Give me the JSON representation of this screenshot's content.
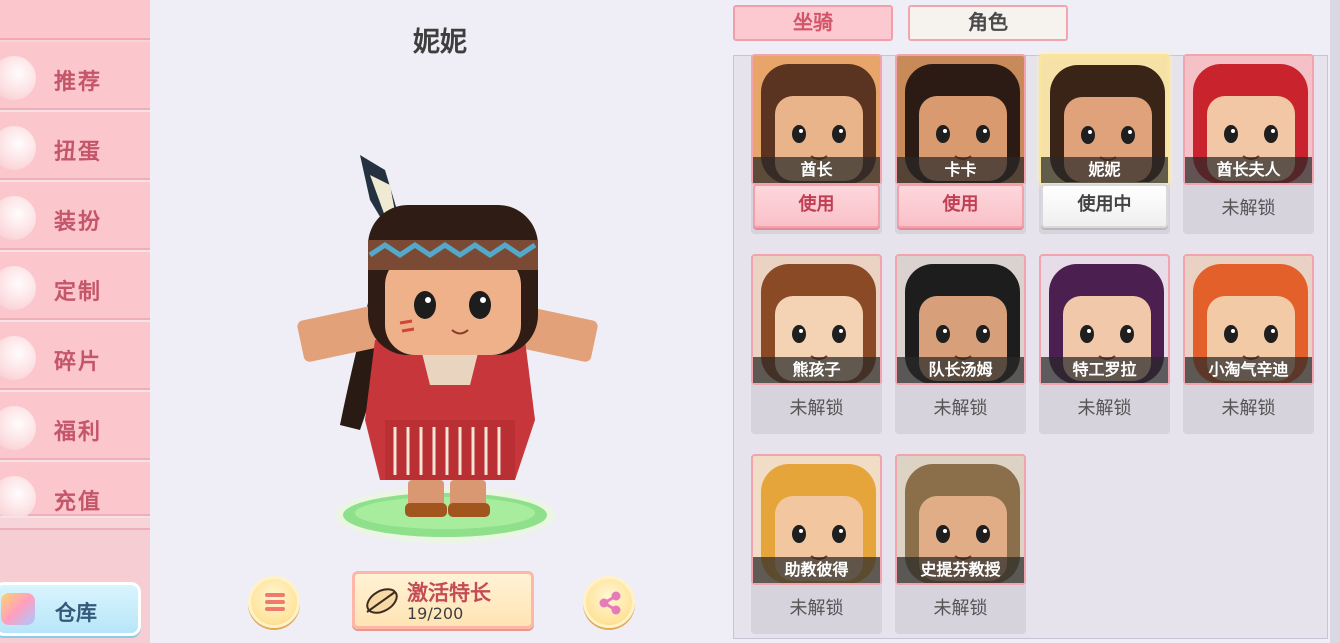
{
  "sidebar": {
    "items": [
      {
        "label": "推荐",
        "icon": "recommend-icon"
      },
      {
        "label": "扭蛋",
        "icon": "gacha-icon"
      },
      {
        "label": "装扮",
        "icon": "outfit-icon"
      },
      {
        "label": "定制",
        "icon": "customize-icon"
      },
      {
        "label": "碎片",
        "icon": "fragment-icon"
      },
      {
        "label": "福利",
        "icon": "gift-icon"
      },
      {
        "label": "充值",
        "icon": "recharge-icon"
      }
    ],
    "warehouse_label": "仓库"
  },
  "character": {
    "name": "妮妮"
  },
  "activate": {
    "title": "激活特长",
    "progress": "19/200",
    "progress_value": 19,
    "progress_max": 200
  },
  "tabs": {
    "mount": "坐骑",
    "role": "角色"
  },
  "skins": [
    {
      "name": "酋长",
      "status": "使用",
      "state": "available",
      "colors": {
        "hair": "#5a3420",
        "skin": "#e9b48a",
        "bg": "#e7a56a"
      }
    },
    {
      "name": "卡卡",
      "status": "使用",
      "state": "available",
      "colors": {
        "hair": "#2c1b14",
        "skin": "#d89a6e",
        "bg": "#c98a5a"
      }
    },
    {
      "name": "妮妮",
      "status": "使用中",
      "state": "in-use",
      "colors": {
        "hair": "#3a2418",
        "skin": "#e0a27a",
        "bg": "#f6e2a6"
      }
    },
    {
      "name": "酋长夫人",
      "status": "未解锁",
      "state": "locked",
      "colors": {
        "hair": "#c9232e",
        "skin": "#f2c7a5",
        "bg": "#f3c1c6"
      }
    },
    {
      "name": "熊孩子",
      "status": "未解锁",
      "state": "locked",
      "colors": {
        "hair": "#8a4a26",
        "skin": "#f3d3b3",
        "bg": "#ead3c2"
      }
    },
    {
      "name": "队长汤姆",
      "status": "未解锁",
      "state": "locked",
      "colors": {
        "hair": "#1d1d1d",
        "skin": "#d7a07a",
        "bg": "#d9d2cf"
      }
    },
    {
      "name": "特工罗拉",
      "status": "未解锁",
      "state": "locked",
      "colors": {
        "hair": "#4b1f4f",
        "skin": "#f1c8aa",
        "bg": "#e7dde9"
      }
    },
    {
      "name": "小淘气辛迪",
      "status": "未解锁",
      "state": "locked",
      "colors": {
        "hair": "#e4602a",
        "skin": "#f3caa6",
        "bg": "#e9d2c4"
      }
    },
    {
      "name": "助教彼得",
      "status": "未解锁",
      "state": "locked",
      "colors": {
        "hair": "#e5a53a",
        "skin": "#f2c79f",
        "bg": "#f1dcc6"
      }
    },
    {
      "name": "史提芬教授",
      "status": "未解锁",
      "state": "locked",
      "colors": {
        "hair": "#8a6f4a",
        "skin": "#e1ad86",
        "bg": "#dcd3c5"
      }
    }
  ]
}
